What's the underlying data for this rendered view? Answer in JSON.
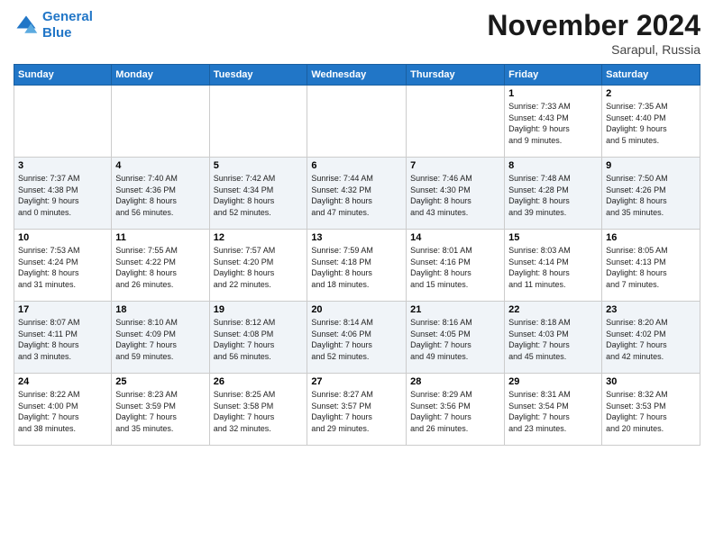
{
  "header": {
    "logo_line1": "General",
    "logo_line2": "Blue",
    "month": "November 2024",
    "location": "Sarapul, Russia"
  },
  "columns": [
    "Sunday",
    "Monday",
    "Tuesday",
    "Wednesday",
    "Thursday",
    "Friday",
    "Saturday"
  ],
  "weeks": [
    [
      {
        "day": "",
        "info": ""
      },
      {
        "day": "",
        "info": ""
      },
      {
        "day": "",
        "info": ""
      },
      {
        "day": "",
        "info": ""
      },
      {
        "day": "",
        "info": ""
      },
      {
        "day": "1",
        "info": "Sunrise: 7:33 AM\nSunset: 4:43 PM\nDaylight: 9 hours\nand 9 minutes."
      },
      {
        "day": "2",
        "info": "Sunrise: 7:35 AM\nSunset: 4:40 PM\nDaylight: 9 hours\nand 5 minutes."
      }
    ],
    [
      {
        "day": "3",
        "info": "Sunrise: 7:37 AM\nSunset: 4:38 PM\nDaylight: 9 hours\nand 0 minutes."
      },
      {
        "day": "4",
        "info": "Sunrise: 7:40 AM\nSunset: 4:36 PM\nDaylight: 8 hours\nand 56 minutes."
      },
      {
        "day": "5",
        "info": "Sunrise: 7:42 AM\nSunset: 4:34 PM\nDaylight: 8 hours\nand 52 minutes."
      },
      {
        "day": "6",
        "info": "Sunrise: 7:44 AM\nSunset: 4:32 PM\nDaylight: 8 hours\nand 47 minutes."
      },
      {
        "day": "7",
        "info": "Sunrise: 7:46 AM\nSunset: 4:30 PM\nDaylight: 8 hours\nand 43 minutes."
      },
      {
        "day": "8",
        "info": "Sunrise: 7:48 AM\nSunset: 4:28 PM\nDaylight: 8 hours\nand 39 minutes."
      },
      {
        "day": "9",
        "info": "Sunrise: 7:50 AM\nSunset: 4:26 PM\nDaylight: 8 hours\nand 35 minutes."
      }
    ],
    [
      {
        "day": "10",
        "info": "Sunrise: 7:53 AM\nSunset: 4:24 PM\nDaylight: 8 hours\nand 31 minutes."
      },
      {
        "day": "11",
        "info": "Sunrise: 7:55 AM\nSunset: 4:22 PM\nDaylight: 8 hours\nand 26 minutes."
      },
      {
        "day": "12",
        "info": "Sunrise: 7:57 AM\nSunset: 4:20 PM\nDaylight: 8 hours\nand 22 minutes."
      },
      {
        "day": "13",
        "info": "Sunrise: 7:59 AM\nSunset: 4:18 PM\nDaylight: 8 hours\nand 18 minutes."
      },
      {
        "day": "14",
        "info": "Sunrise: 8:01 AM\nSunset: 4:16 PM\nDaylight: 8 hours\nand 15 minutes."
      },
      {
        "day": "15",
        "info": "Sunrise: 8:03 AM\nSunset: 4:14 PM\nDaylight: 8 hours\nand 11 minutes."
      },
      {
        "day": "16",
        "info": "Sunrise: 8:05 AM\nSunset: 4:13 PM\nDaylight: 8 hours\nand 7 minutes."
      }
    ],
    [
      {
        "day": "17",
        "info": "Sunrise: 8:07 AM\nSunset: 4:11 PM\nDaylight: 8 hours\nand 3 minutes."
      },
      {
        "day": "18",
        "info": "Sunrise: 8:10 AM\nSunset: 4:09 PM\nDaylight: 7 hours\nand 59 minutes."
      },
      {
        "day": "19",
        "info": "Sunrise: 8:12 AM\nSunset: 4:08 PM\nDaylight: 7 hours\nand 56 minutes."
      },
      {
        "day": "20",
        "info": "Sunrise: 8:14 AM\nSunset: 4:06 PM\nDaylight: 7 hours\nand 52 minutes."
      },
      {
        "day": "21",
        "info": "Sunrise: 8:16 AM\nSunset: 4:05 PM\nDaylight: 7 hours\nand 49 minutes."
      },
      {
        "day": "22",
        "info": "Sunrise: 8:18 AM\nSunset: 4:03 PM\nDaylight: 7 hours\nand 45 minutes."
      },
      {
        "day": "23",
        "info": "Sunrise: 8:20 AM\nSunset: 4:02 PM\nDaylight: 7 hours\nand 42 minutes."
      }
    ],
    [
      {
        "day": "24",
        "info": "Sunrise: 8:22 AM\nSunset: 4:00 PM\nDaylight: 7 hours\nand 38 minutes."
      },
      {
        "day": "25",
        "info": "Sunrise: 8:23 AM\nSunset: 3:59 PM\nDaylight: 7 hours\nand 35 minutes."
      },
      {
        "day": "26",
        "info": "Sunrise: 8:25 AM\nSunset: 3:58 PM\nDaylight: 7 hours\nand 32 minutes."
      },
      {
        "day": "27",
        "info": "Sunrise: 8:27 AM\nSunset: 3:57 PM\nDaylight: 7 hours\nand 29 minutes."
      },
      {
        "day": "28",
        "info": "Sunrise: 8:29 AM\nSunset: 3:56 PM\nDaylight: 7 hours\nand 26 minutes."
      },
      {
        "day": "29",
        "info": "Sunrise: 8:31 AM\nSunset: 3:54 PM\nDaylight: 7 hours\nand 23 minutes."
      },
      {
        "day": "30",
        "info": "Sunrise: 8:32 AM\nSunset: 3:53 PM\nDaylight: 7 hours\nand 20 minutes."
      }
    ]
  ]
}
